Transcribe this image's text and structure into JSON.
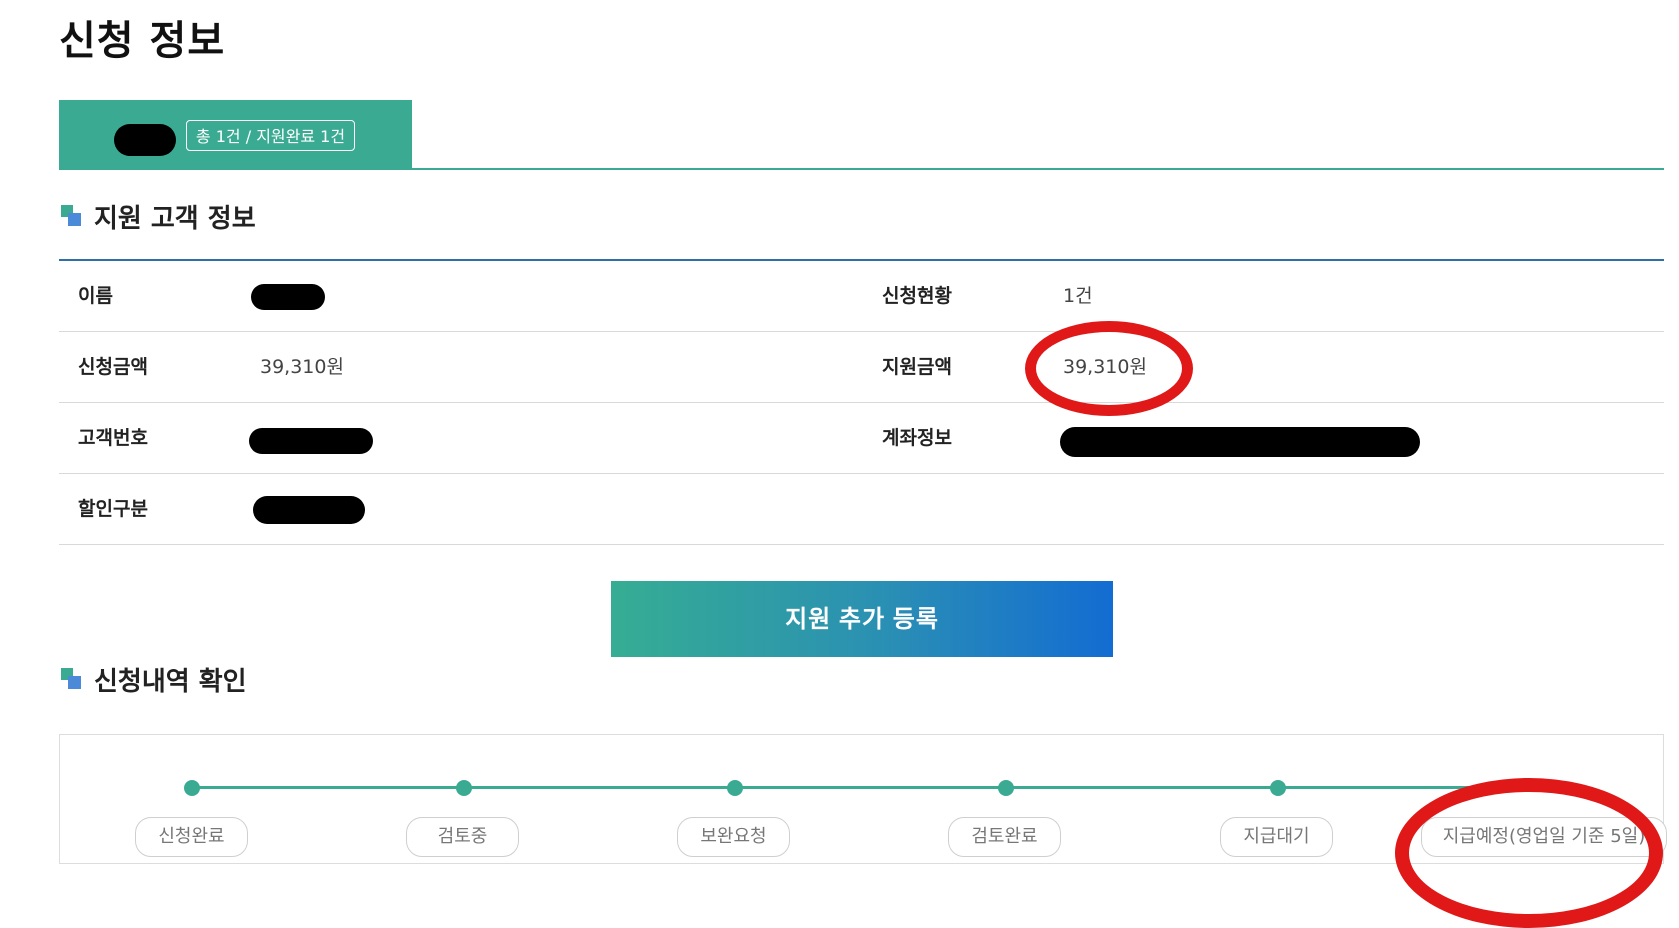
{
  "page_title": "신청 정보",
  "tab": {
    "count_badge": "총 1건 / 지원완료 1건"
  },
  "customer_section": {
    "title": "지원 고객 정보",
    "rows": [
      {
        "label_left": "이름",
        "value_left": "",
        "label_right": "신청현황",
        "value_right": "1건"
      },
      {
        "label_left": "신청금액",
        "value_left": "39,310원",
        "label_right": "지원금액",
        "value_right": "39,310원"
      },
      {
        "label_left": "고객번호",
        "value_left": "",
        "label_right": "계좌정보",
        "value_right": ""
      },
      {
        "label_left": "할인구분",
        "value_left": ""
      }
    ]
  },
  "add_button_label": "지원 추가 등록",
  "history_section": {
    "title": "신청내역 확인",
    "steps": [
      "신청완료",
      "검토중",
      "보완요청",
      "검토완료",
      "지급대기",
      "지급예정(영업일 기준 5일)"
    ]
  },
  "colors": {
    "accent_green": "#3aab92",
    "accent_blue": "#136cd2",
    "annotation_red": "#e01818"
  }
}
